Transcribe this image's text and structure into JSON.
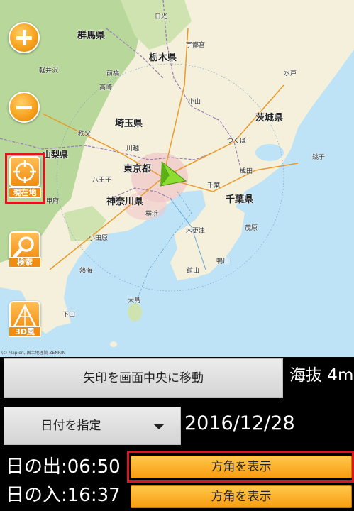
{
  "map": {
    "labels": {
      "gunma": "群馬県",
      "tochigi": "栃木県",
      "ibaraki": "茨城県",
      "saitama": "埼玉県",
      "yamanashi": "山梨県",
      "tokyo": "東京都",
      "kanagawa": "神奈川県",
      "chiba": "千葉県",
      "utsunomiya": "宇都宮",
      "nikko": "日光",
      "maebashi": "前橋",
      "takasaki": "高崎",
      "mito": "水戸",
      "tsukuba": "つくば",
      "kawagoe": "川越",
      "hachioji": "八王子",
      "yokohama": "横浜",
      "kofu": "甲府",
      "chiba_city": "千葉",
      "kisarazu": "木更津",
      "tateyama": "館山",
      "izu_oshima": "大島",
      "oyama": "小山",
      "karuizawa": "軽井沢",
      "chichibu": "秩父",
      "odawara": "小田原",
      "atami": "熱海",
      "shimoda": "下田",
      "narita": "成田",
      "choshi": "銚子",
      "mobara": "茂原",
      "kamogawa": "鴨川"
    },
    "copyright": "(c) Mapion, 国土地理院 ZENRIN"
  },
  "controls": {
    "current_location_label": "現在地",
    "search_label": "検索",
    "view3d_label": "3D風"
  },
  "panel": {
    "move_arrow_label": "矢印を画面中央に移動",
    "altitude": "海抜 4m",
    "date_select_label": "日付を指定",
    "date_value": "2016/12/28",
    "sunrise": "日の出:06:50",
    "sunset": "日の入:16:37",
    "azimuth_sunrise_label": "方角を表示",
    "azimuth_sunset_label": "方角を表示"
  },
  "colors": {
    "accent_orange": "#f89c12",
    "highlight_red": "#e0141e",
    "sea": "#bfe3f6",
    "land": "#f4f0dc",
    "mountain": "#b8d79a"
  }
}
